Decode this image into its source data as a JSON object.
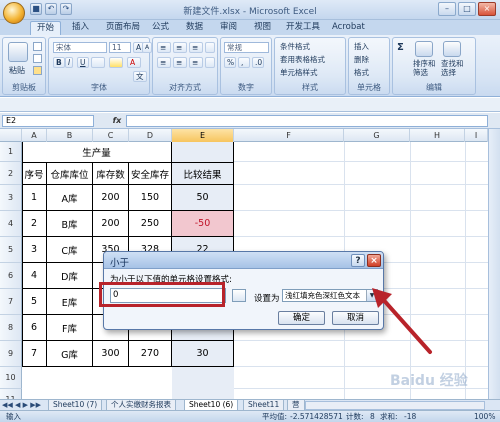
{
  "window": {
    "title": "新建文件.xlsx - Microsoft Excel",
    "controls": [
      "–",
      "□",
      "×"
    ]
  },
  "ribbon_tabs": [
    "开始",
    "插入",
    "页面布局",
    "公式",
    "数据",
    "审阅",
    "视图",
    "开发工具",
    "Acrobat"
  ],
  "ribbon": {
    "clipboard": {
      "paste": "粘贴",
      "label": "剪贴板"
    },
    "font": {
      "name": "宋体",
      "size": "11",
      "label": "字体",
      "wen": "文",
      "bold": "B",
      "italic": "I",
      "underline": "U",
      "grow": "A",
      "shrink": "A"
    },
    "alignment": {
      "label": "对齐方式"
    },
    "number": {
      "format": "常规",
      "label": "数字"
    },
    "styles": {
      "items": [
        "条件格式",
        "套用表格格式",
        "单元格样式"
      ],
      "label": "样式"
    },
    "cells": {
      "items": [
        "插入",
        "删除",
        "格式"
      ],
      "label": "单元格"
    },
    "editing": {
      "sum": "Σ",
      "sort": "排序和\n筛选",
      "find": "查找和\n选择",
      "label": "编辑"
    }
  },
  "name_box": "E2",
  "fx": "fx",
  "columns": [
    "A",
    "B",
    "C",
    "D",
    "E",
    "F",
    "G",
    "H",
    "I"
  ],
  "rows": [
    "1",
    "2",
    "3",
    "4",
    "5",
    "6",
    "7",
    "8",
    "9",
    "10",
    "11"
  ],
  "selected_column": "E",
  "table": {
    "merged_header": "生产量",
    "headers": [
      "序号",
      "仓库库位",
      "库存数",
      "安全库存",
      "比较结果"
    ],
    "data": [
      [
        "1",
        "A库",
        "200",
        "150",
        "50"
      ],
      [
        "2",
        "B库",
        "200",
        "250",
        "-50"
      ],
      [
        "3",
        "C库",
        "350",
        "328",
        "22"
      ],
      [
        "4",
        "D库",
        "",
        "",
        ""
      ],
      [
        "5",
        "E库",
        "",
        "",
        ""
      ],
      [
        "6",
        "F库",
        "",
        "",
        ""
      ],
      [
        "7",
        "G库",
        "300",
        "270",
        "30"
      ]
    ]
  },
  "dialog": {
    "title": "小于",
    "prompt": "为小于以下值的单元格设置格式:",
    "value": "0",
    "set_as_label": "设置为",
    "format_option": "浅红填充色深红色文本",
    "ok": "确定",
    "cancel": "取消",
    "help": "?",
    "close": "×"
  },
  "sheet_tabs": [
    "Sheet10 (7)",
    "个人实缴财务报表",
    "Sheet10 (6)",
    "Sheet11",
    "营"
  ],
  "active_sheet": "Sheet10 (6)",
  "status": {
    "mode": "输入",
    "average_label": "平均值:",
    "average": "-2.571428571",
    "count_label": "计数:",
    "count": "8",
    "sum_label": "求和:",
    "sum": "-18",
    "zoom": "100%"
  },
  "watermark": "Baidu 经验",
  "colors": {
    "negative_fill": "#f2c7cf",
    "negative_text": "#c0152a",
    "selected_col_fill": "#e7edf6",
    "highlight": "#b8232a"
  }
}
